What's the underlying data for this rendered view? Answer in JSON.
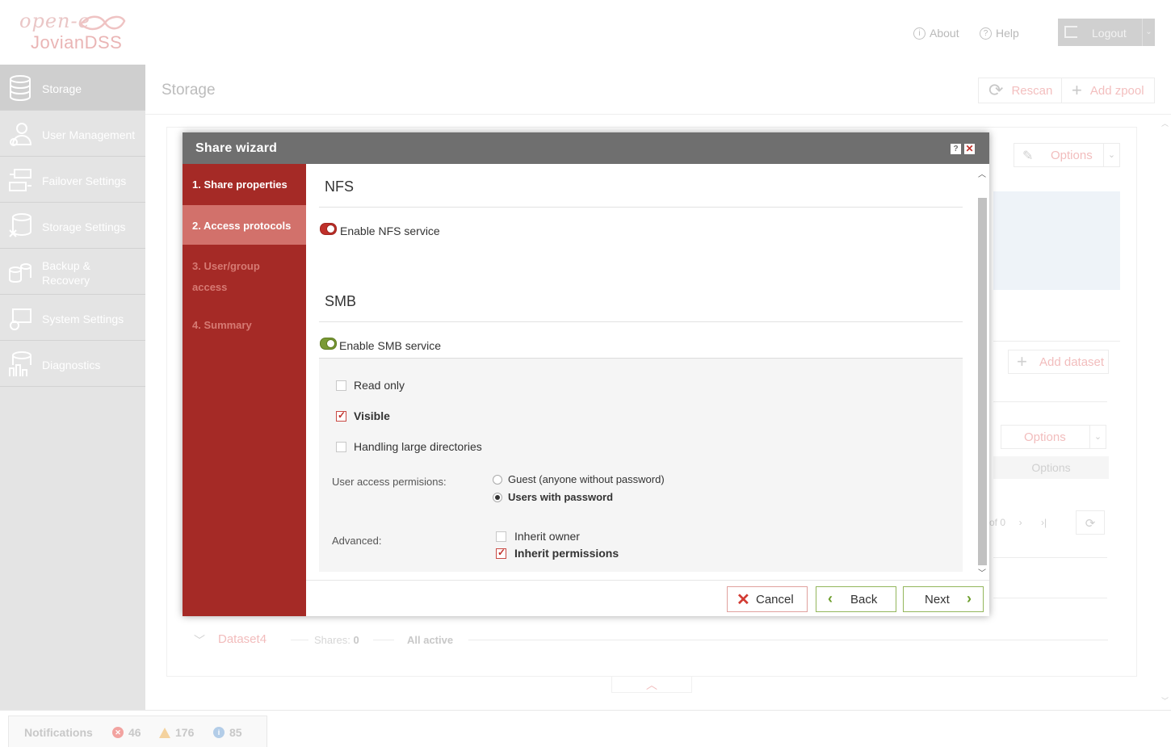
{
  "app": {
    "logo_top": "open-e",
    "logo_bottom": "JovianDSS",
    "about": "About",
    "help": "Help",
    "logout": "Logout"
  },
  "sidebar": {
    "items": [
      {
        "label": "Storage",
        "icon": "storage-icon",
        "active": true
      },
      {
        "label": "User Management",
        "icon": "user-management-icon"
      },
      {
        "label": "Failover Settings",
        "icon": "failover-icon"
      },
      {
        "label": "Storage Settings",
        "icon": "storage-settings-icon"
      },
      {
        "label": "Backup & Recovery",
        "icon": "backup-icon"
      },
      {
        "label": "System Settings",
        "icon": "system-settings-icon"
      },
      {
        "label": "Diagnostics",
        "icon": "diagnostics-icon"
      }
    ]
  },
  "page": {
    "title": "Storage",
    "rescan": "Rescan",
    "add_zpool": "Add zpool",
    "options": "Options",
    "add_dataset": "Add dataset",
    "options2": "Options",
    "options3": "Options",
    "pager_text": "of 0",
    "dataset_name": "Dataset4",
    "shares_label": "Shares:",
    "shares_count": "0",
    "status": "All active"
  },
  "notifications": {
    "label": "Notifications",
    "errors": "46",
    "warnings": "176",
    "info": "85"
  },
  "wizard": {
    "title": "Share wizard",
    "steps": [
      "1. Share properties",
      "2. Access protocols",
      "3. User/group access",
      "4. Summary"
    ],
    "nfs": {
      "title": "NFS",
      "toggle_label": "Enable NFS service",
      "enabled": false
    },
    "smb": {
      "title": "SMB",
      "toggle_label": "Enable SMB service",
      "enabled": true,
      "read_only": "Read only",
      "visible": "Visible",
      "large_dirs": "Handling large directories",
      "user_access_label": "User access permisions:",
      "guest_option": "Guest (anyone without password)",
      "users_option": "Users with password",
      "advanced_label": "Advanced:",
      "inherit_owner": "Inherit owner",
      "inherit_permissions": "Inherit permissions"
    },
    "buttons": {
      "cancel": "Cancel",
      "back": "Back",
      "next": "Next"
    }
  },
  "colors": {
    "accent_red": "#a52a26",
    "active_step": "#d2716b",
    "green_button": "#6d9e2c",
    "toggle_off": "#c0302a",
    "toggle_on": "#7a9a35"
  }
}
